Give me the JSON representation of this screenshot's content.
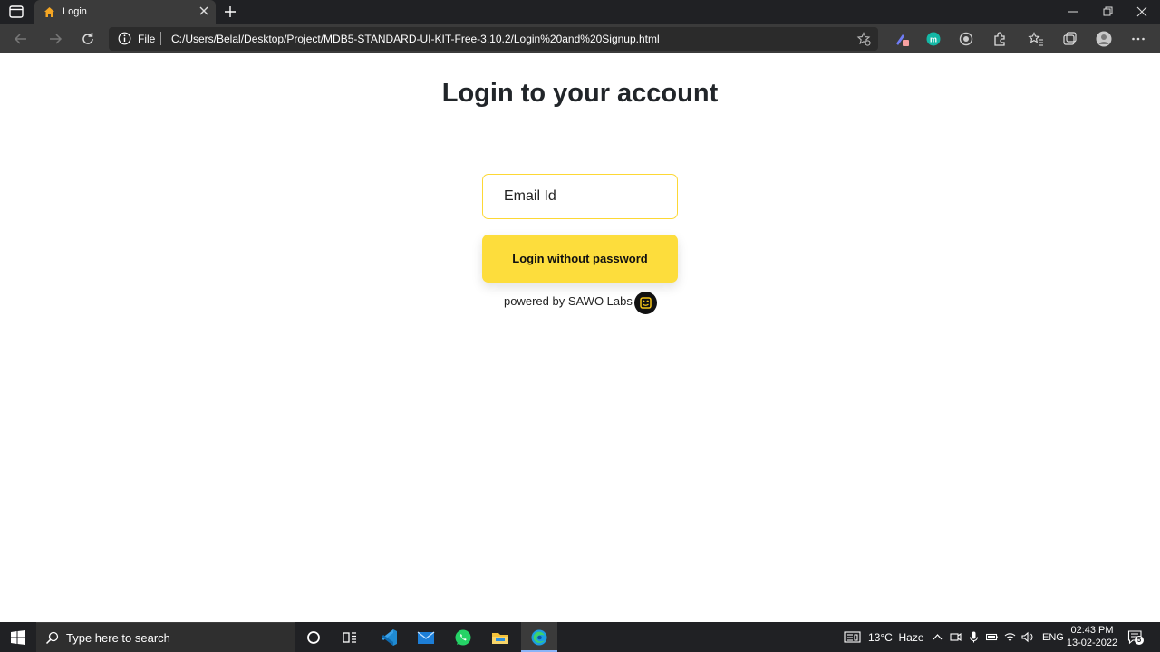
{
  "browser": {
    "tab_title": "Login",
    "address": {
      "scheme_label": "File",
      "url": "C:/Users/Belal/Desktop/Project/MDB5-STANDARD-UI-KIT-Free-3.10.2/Login%20and%20Signup.html"
    },
    "icons": {
      "tab_actions": "tab-actions-icon",
      "favicon": "home-favicon-icon",
      "close": "close-icon",
      "new_tab": "plus-icon",
      "back": "back-arrow-icon",
      "forward": "forward-arrow-icon",
      "refresh": "refresh-icon",
      "info": "info-icon",
      "favorite": "add-favorite-icon"
    }
  },
  "page": {
    "title": "Login to your account",
    "email_placeholder": "Email Id",
    "login_button": "Login without password",
    "powered_by": "powered by SAWO Labs"
  },
  "taskbar": {
    "search_placeholder": "Type here to search",
    "weather": "13°C  Haze",
    "language": "ENG",
    "time": "02:43 PM",
    "date": "13-02-2022",
    "notifications_count": "5"
  },
  "colors": {
    "accent_yellow": "#fddd3c",
    "input_border": "#fdd835",
    "chrome_dark": "#202124",
    "toolbar": "#3b3b3b"
  }
}
